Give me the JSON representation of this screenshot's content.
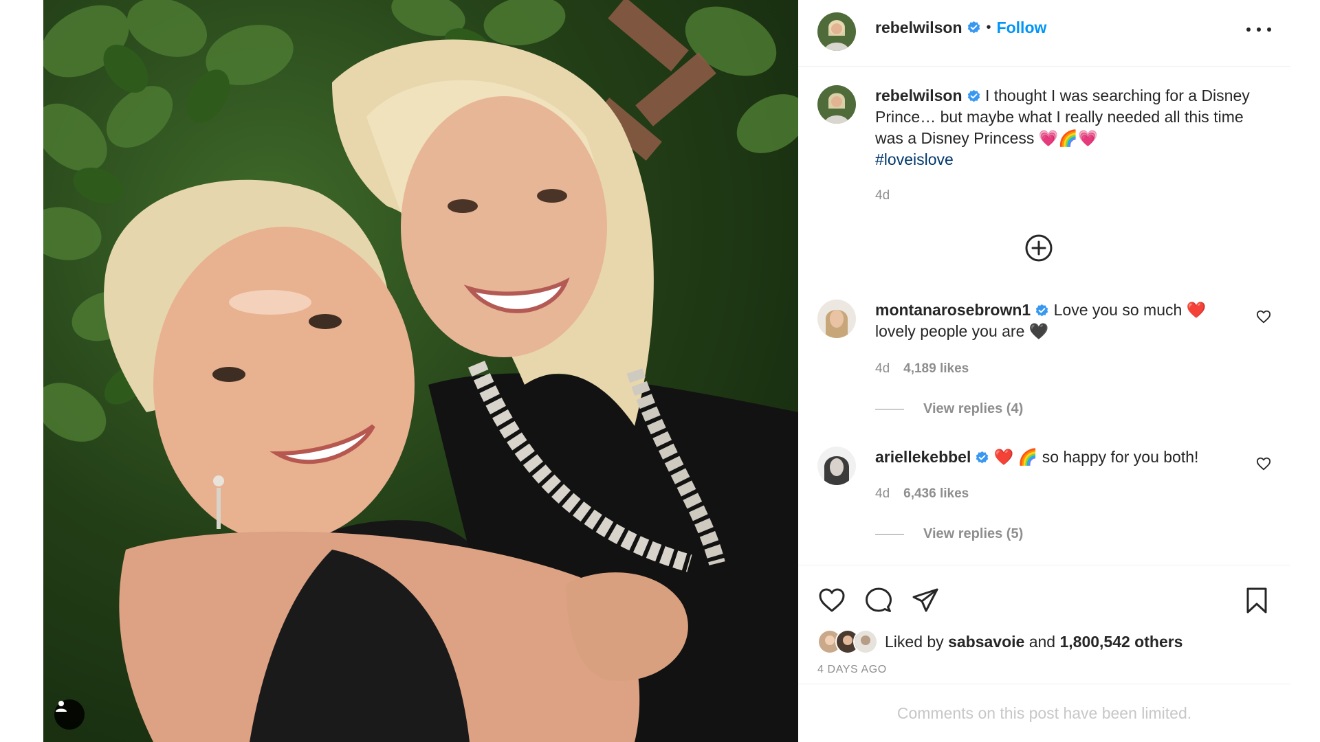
{
  "colors": {
    "accent": "#0095f6",
    "verified_blue": "#3897f0",
    "hashtag": "#00376b",
    "muted": "#8e8e8e",
    "divider": "#efefef"
  },
  "photo": {
    "alt_icon": "user-tag-icon"
  },
  "header": {
    "username": "rebelwilson",
    "separator": "•",
    "follow_label": "Follow",
    "more_icon": "more-options-icon"
  },
  "caption": {
    "username": "rebelwilson",
    "text": "I thought I was searching for a Disney Prince… but maybe what I really needed all this time was a Disney Princess 💗🌈💗",
    "hashtag": "#loveislove",
    "time": "4d"
  },
  "load_more_icon": "plus-circle-icon",
  "comments": [
    {
      "username": "montanarosebrown1",
      "text": "Love you so much ❤️ lovely people you are 🖤",
      "time": "4d",
      "likes": "4,189 likes",
      "replies": "View replies (4)"
    },
    {
      "username": "ariellekebbel",
      "text": "❤️ 🌈 so happy for you both!",
      "time": "4d",
      "likes": "6,436 likes",
      "replies": "View replies (5)"
    }
  ],
  "actions": {
    "like_icon": "heart-icon",
    "comment_icon": "comment-icon",
    "share_icon": "share-icon",
    "save_icon": "bookmark-icon"
  },
  "likes": {
    "prefix": "Liked by",
    "first_liker": "sabsavoie",
    "and": "and",
    "others": "1,800,542 others"
  },
  "post_date": "4 DAYS AGO",
  "comments_limited": "Comments on this post have been limited."
}
